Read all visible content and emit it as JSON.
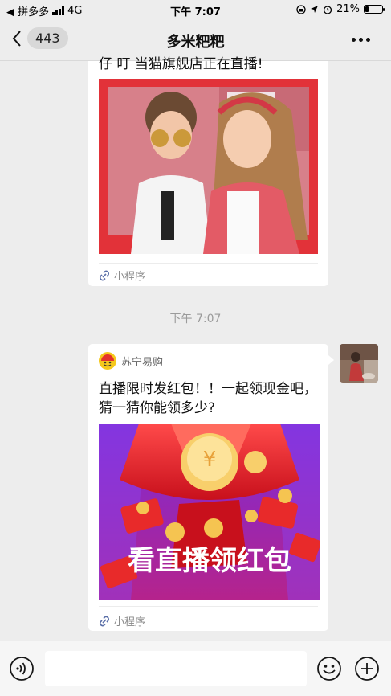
{
  "status_bar": {
    "carrier": "◀ 拼多多",
    "network": "4G",
    "time": "下午 7:07",
    "battery": "21%",
    "battery_level": 0.21
  },
  "nav": {
    "unread_count": "443",
    "title": "多米粑粑"
  },
  "messages": [
    {
      "title_partial": "仔 叮 当猫旗舰店正在直播!",
      "image_desc": "kids-photo",
      "tag": "小程序"
    },
    {
      "source": "苏宁易购",
      "title": "直播限时发红包！！一起领现金吧，猜一猜你能领多少?",
      "image_text": "看直播领红包",
      "tag": "小程序"
    }
  ],
  "timestamp": "下午 7:07",
  "input": {
    "placeholder": ""
  },
  "colors": {
    "background": "#ededed",
    "accent_red": "#e02a33"
  }
}
